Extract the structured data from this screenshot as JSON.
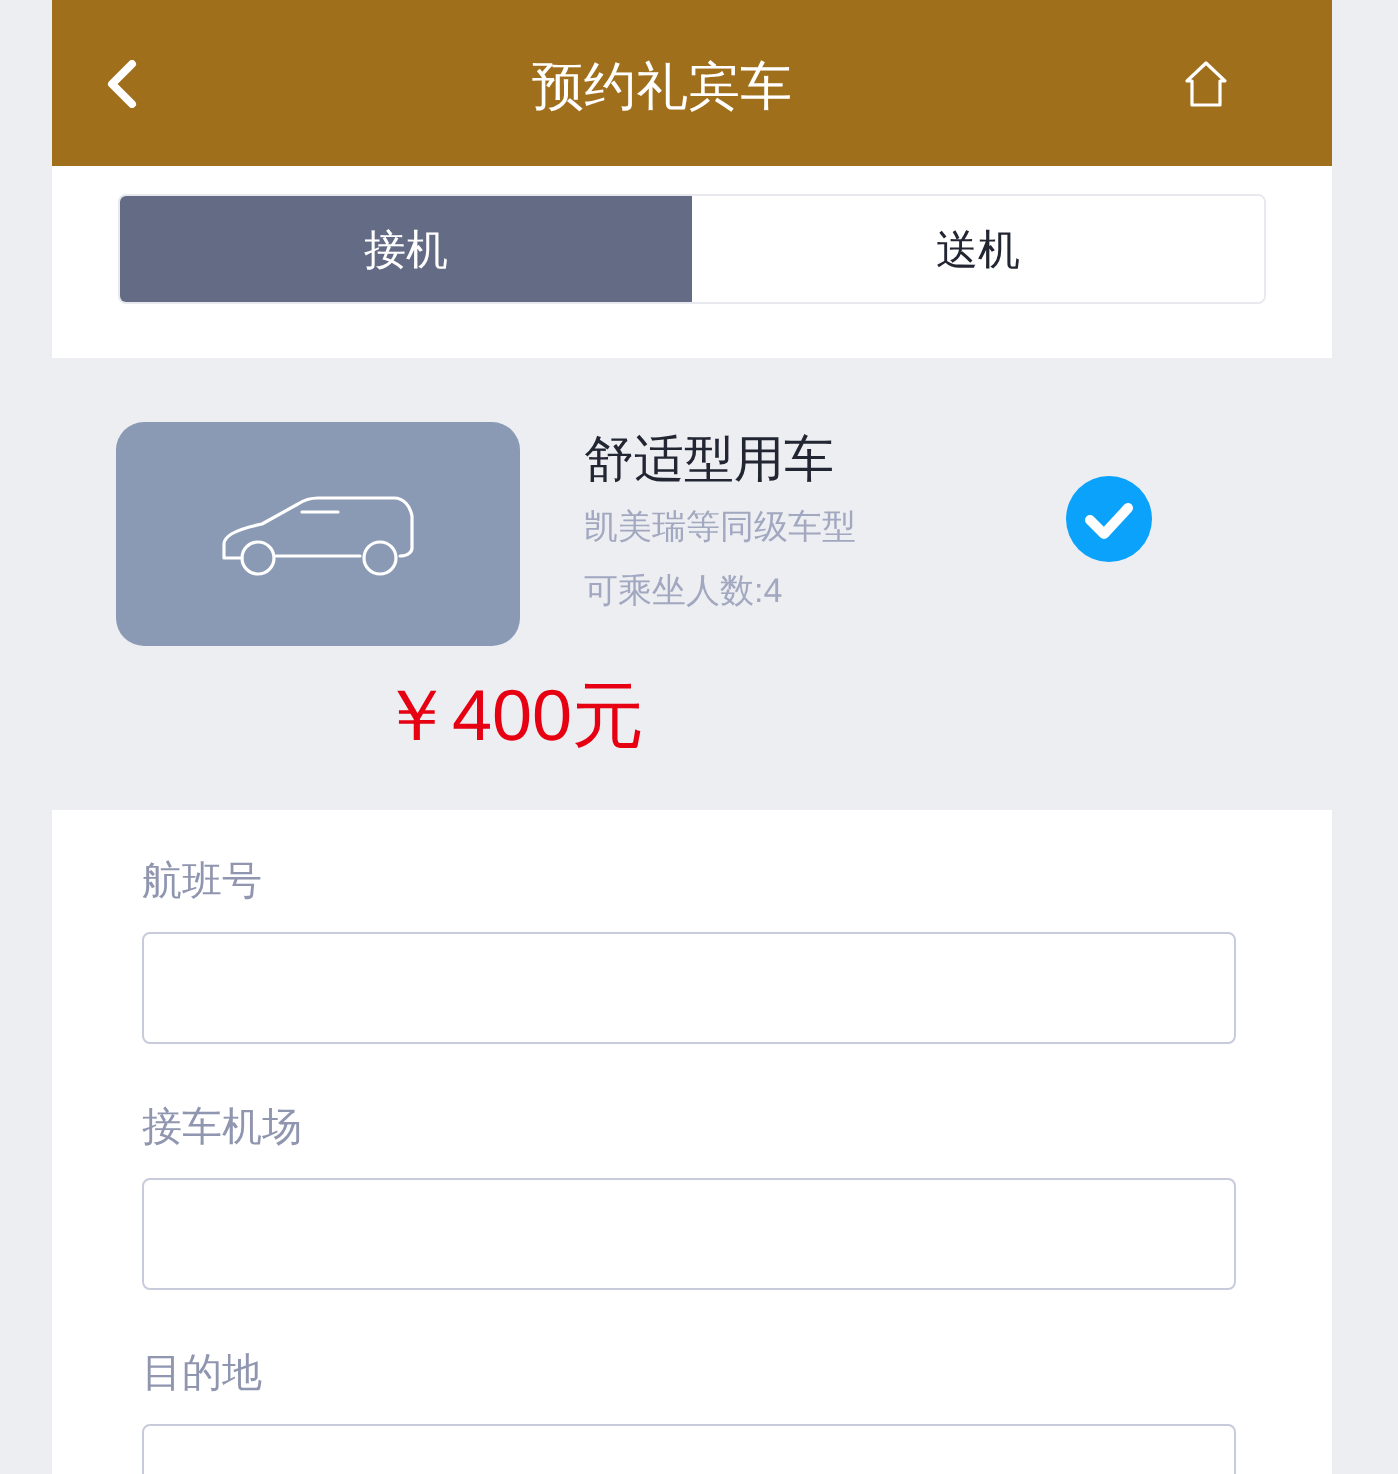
{
  "header": {
    "title": "预约礼宾车"
  },
  "tabs": [
    {
      "label": "接机",
      "selected": true
    },
    {
      "label": "送机",
      "selected": false
    }
  ],
  "car_option": {
    "name": "舒适型用车",
    "model": "凯美瑞等同级车型",
    "capacity": "可乘坐人数:4",
    "selected": true,
    "price": "￥400元"
  },
  "form": {
    "fields": [
      {
        "label": "航班号"
      },
      {
        "label": "接车机场"
      },
      {
        "label": "目的地"
      }
    ]
  }
}
